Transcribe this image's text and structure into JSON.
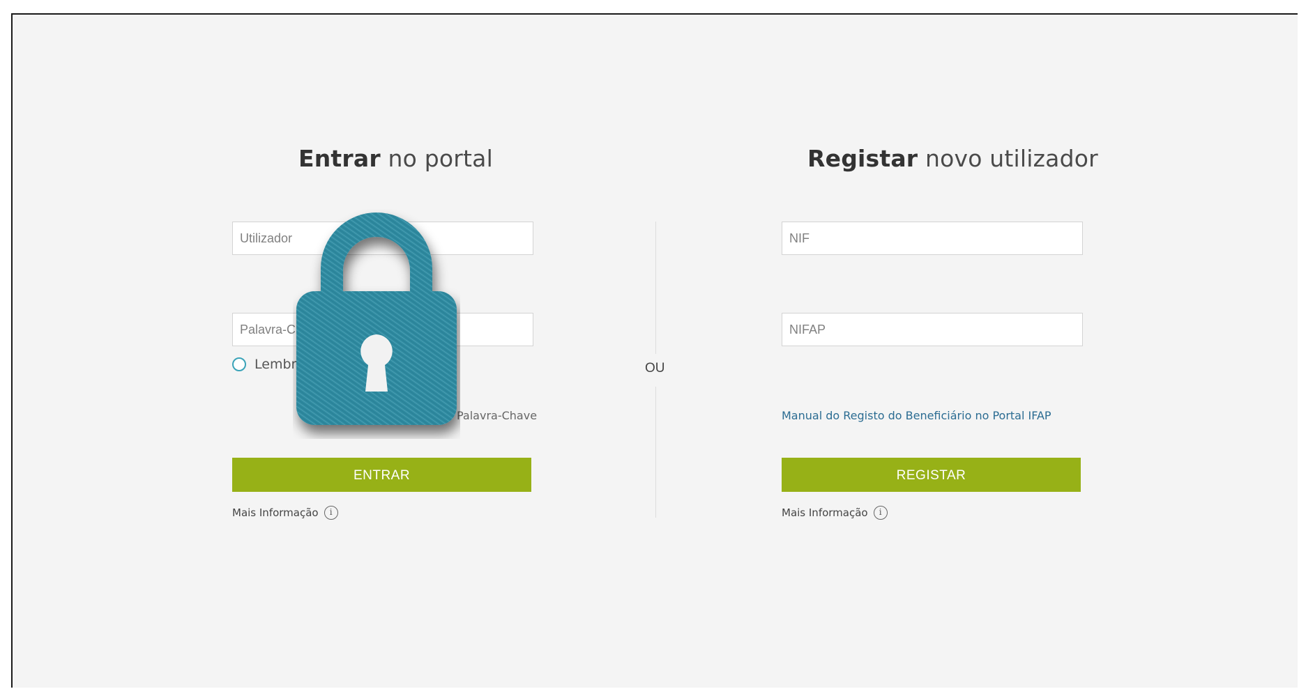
{
  "login": {
    "title_bold": "Entrar",
    "title_rest": " no portal",
    "username_placeholder": "Utilizador",
    "password_placeholder": "Palavra-Chave",
    "remember_label": "Lembrar",
    "forgot_link": "Palavra-Chave",
    "submit_label": "ENTRAR",
    "more_info": "Mais Informação"
  },
  "separator": {
    "label": "OU"
  },
  "register": {
    "title_bold": "Registar",
    "title_rest": " novo utilizador",
    "nif_placeholder": "NIF",
    "nifap_placeholder": "NIFAP",
    "manual_link": "Manual do Registo do Beneficiário no Portal IFAP",
    "submit_label": "REGISTAR",
    "more_info": "Mais Informação"
  },
  "overlay": {
    "icon": "padlock-icon",
    "color": "#2f8aa0"
  },
  "colors": {
    "button": "#97b117",
    "link": "#2b6c92",
    "background": "#f4f4f4"
  }
}
